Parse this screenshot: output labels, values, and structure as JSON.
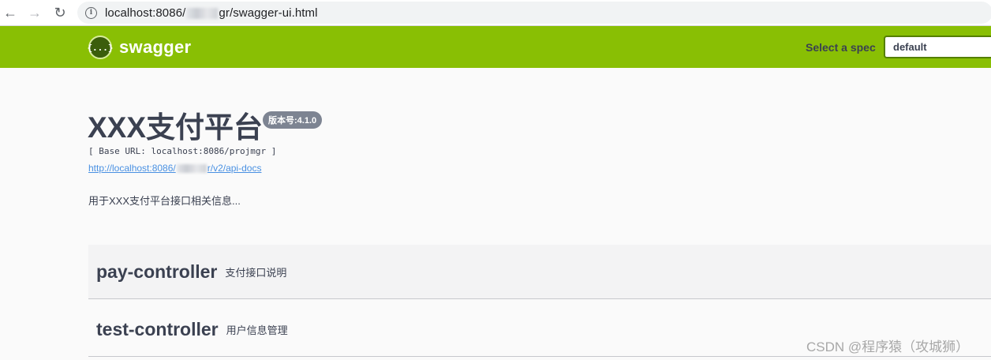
{
  "browser": {
    "url_prefix": "localhost:8086/",
    "url_suffix": "gr/swagger-ui.html"
  },
  "topbar": {
    "logo_symbol": "{...}",
    "logo_text": "swagger",
    "spec_label": "Select a spec",
    "spec_value": "default",
    "accent_color": "#89bf04"
  },
  "info": {
    "title": "XXX支付平台",
    "version": "版本号:4.1.0",
    "base_url": "[ Base URL: localhost:8086/projmgr ]",
    "docs_link_prefix": "http://localhost:8086/",
    "docs_link_suffix": "r/v2/api-docs",
    "description": "用于XXX支付平台接口相关信息..."
  },
  "tags": [
    {
      "name": "pay-controller",
      "description": "支付接口说明"
    },
    {
      "name": "test-controller",
      "description": "用户信息管理"
    }
  ],
  "watermark": "CSDN @程序猿（攻城狮）"
}
